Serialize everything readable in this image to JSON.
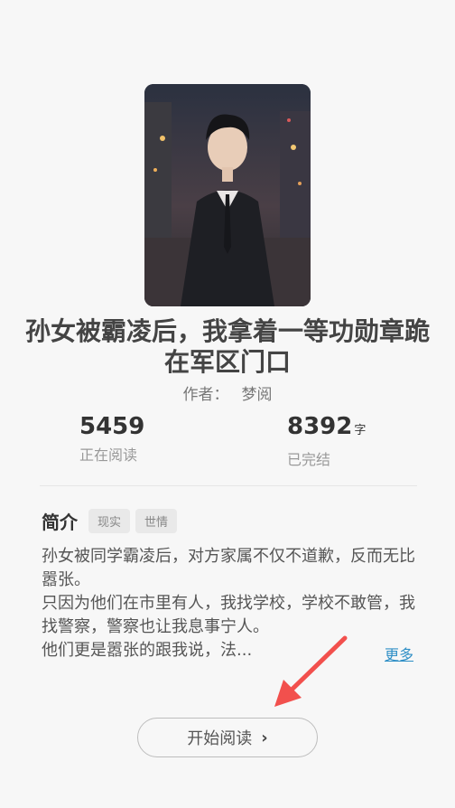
{
  "book": {
    "title": "孙女被霸凌后，我拿着一等功勋章跪在军区门口",
    "author_label": "作者：",
    "author": "梦阅"
  },
  "stats": {
    "reading_count": "5459",
    "reading_label": "正在阅读",
    "word_count": "8392",
    "word_unit": "字",
    "status_label": "已完结"
  },
  "intro": {
    "heading": "简介",
    "tags": [
      "现实",
      "世情"
    ],
    "lines": [
      "孙女被同学霸凌后，对方家属不仅不道歉，反而无比嚣张。",
      "只因为他们在市里有人，我找学校，学校不敢管，我找警察，警察也让我息事宁人。",
      "他们更是嚣张的跟我说，法..."
    ],
    "more_label": "更多"
  },
  "actions": {
    "start_label": "开始阅读",
    "start_icon": "chevron-right-icon"
  },
  "colors": {
    "link": "#2f8fc6",
    "arrow": "#f2504d"
  }
}
